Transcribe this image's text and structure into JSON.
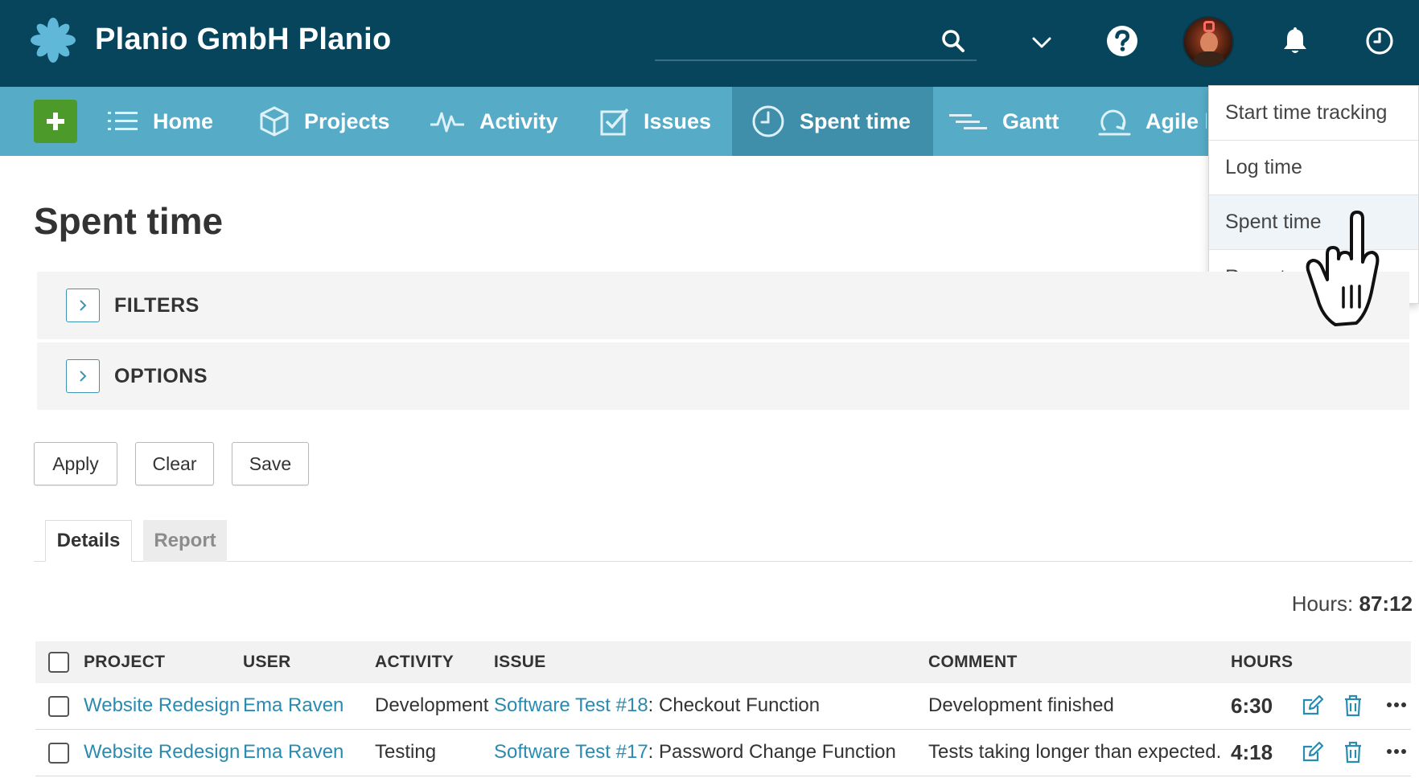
{
  "app": {
    "title": "Planio GmbH Planio",
    "colors": {
      "topbar": "#06455c",
      "navbar": "#56abc6",
      "nav_active": "#3f8fab",
      "add_button": "#4c9a2a",
      "link": "#2a8ab0"
    }
  },
  "header": {
    "search": {
      "placeholder": "",
      "icon": "search-icon"
    },
    "icons": [
      "chevron-down-icon",
      "help-icon",
      "avatar",
      "bell-icon",
      "clock-icon"
    ]
  },
  "nav": {
    "add_label": "+",
    "items": [
      {
        "label": "Home",
        "icon": "list-icon"
      },
      {
        "label": "Projects",
        "icon": "cube-icon"
      },
      {
        "label": "Activity",
        "icon": "pulse-icon"
      },
      {
        "label": "Issues",
        "icon": "checkbox-icon"
      },
      {
        "label": "Spent time",
        "icon": "clock-icon",
        "active": true
      },
      {
        "label": "Gantt",
        "icon": "gantt-icon"
      },
      {
        "label": "Agile board",
        "icon": "agile-icon"
      }
    ]
  },
  "dropdown": {
    "items": [
      {
        "label": "Start time tracking"
      },
      {
        "label": "Log time"
      },
      {
        "label": "Spent time",
        "hover": true
      },
      {
        "label": "Report"
      }
    ]
  },
  "page": {
    "title": "Spent time",
    "panels": {
      "filters": "FILTERS",
      "options": "OPTIONS"
    },
    "buttons": {
      "apply": "Apply",
      "clear": "Clear",
      "save": "Save"
    },
    "tabs": {
      "details": "Details",
      "report": "Report"
    },
    "hours_total": {
      "label": "Hours:",
      "value": "87:12"
    }
  },
  "table": {
    "headers": {
      "project": "PROJECT",
      "user": "USER",
      "activity": "ACTIVITY",
      "issue": "ISSUE",
      "comment": "COMMENT",
      "hours": "HOURS"
    },
    "rows": [
      {
        "project": "Website Redesign",
        "user": "Ema Raven",
        "activity": "Development",
        "issue_link": "Software Test #18",
        "issue_title": ": Checkout Function",
        "comment": "Development finished",
        "hours": "6:30"
      },
      {
        "project": "Website Redesign",
        "user": "Ema Raven",
        "activity": "Testing",
        "issue_link": "Software Test #17",
        "issue_title": ": Password Change Function",
        "comment": "Tests taking longer than expected.",
        "hours": "4:18"
      }
    ]
  }
}
